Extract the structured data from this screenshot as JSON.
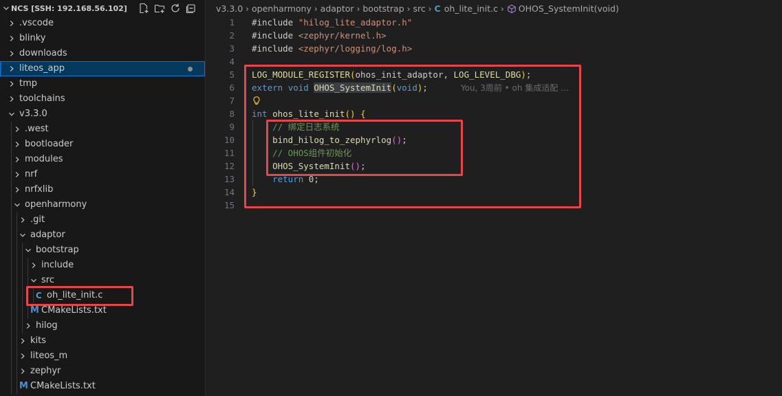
{
  "explorer": {
    "root_title": "NCS [SSH: 192.168.56.102]",
    "actions": [
      "new-file-icon",
      "new-folder-icon",
      "refresh-icon",
      "collapse-all-icon"
    ],
    "items": [
      {
        "label": ".vscode",
        "depth": 0,
        "type": "folder",
        "expanded": false
      },
      {
        "label": "blinky",
        "depth": 0,
        "type": "folder",
        "expanded": false
      },
      {
        "label": "downloads",
        "depth": 0,
        "type": "folder",
        "expanded": false
      },
      {
        "label": "liteos_app",
        "depth": 0,
        "type": "folder",
        "expanded": false,
        "selected": true,
        "modified": true
      },
      {
        "label": "tmp",
        "depth": 0,
        "type": "folder",
        "expanded": false
      },
      {
        "label": "toolchains",
        "depth": 0,
        "type": "folder",
        "expanded": false
      },
      {
        "label": "v3.3.0",
        "depth": 0,
        "type": "folder",
        "expanded": true
      },
      {
        "label": ".west",
        "depth": 1,
        "type": "folder",
        "expanded": false
      },
      {
        "label": "bootloader",
        "depth": 1,
        "type": "folder",
        "expanded": false
      },
      {
        "label": "modules",
        "depth": 1,
        "type": "folder",
        "expanded": false
      },
      {
        "label": "nrf",
        "depth": 1,
        "type": "folder",
        "expanded": false
      },
      {
        "label": "nrfxlib",
        "depth": 1,
        "type": "folder",
        "expanded": false
      },
      {
        "label": "openharmony",
        "depth": 1,
        "type": "folder",
        "expanded": true
      },
      {
        "label": ".git",
        "depth": 2,
        "type": "folder",
        "expanded": false
      },
      {
        "label": "adaptor",
        "depth": 2,
        "type": "folder",
        "expanded": true
      },
      {
        "label": "bootstrap",
        "depth": 3,
        "type": "folder",
        "expanded": true
      },
      {
        "label": "include",
        "depth": 4,
        "type": "folder",
        "expanded": false
      },
      {
        "label": "src",
        "depth": 4,
        "type": "folder",
        "expanded": true
      },
      {
        "label": "oh_lite_init.c",
        "depth": 5,
        "type": "c-file",
        "icon_text": "C"
      },
      {
        "label": "CMakeLists.txt",
        "depth": 4,
        "type": "cmake-file",
        "icon_text": "M"
      },
      {
        "label": "hilog",
        "depth": 3,
        "type": "folder",
        "expanded": false
      },
      {
        "label": "kits",
        "depth": 2,
        "type": "folder",
        "expanded": false
      },
      {
        "label": "liteos_m",
        "depth": 2,
        "type": "folder",
        "expanded": false
      },
      {
        "label": "zephyr",
        "depth": 2,
        "type": "folder",
        "expanded": false
      },
      {
        "label": "CMakeLists.txt",
        "depth": 2,
        "type": "cmake-file",
        "icon_text": "M"
      }
    ]
  },
  "breadcrumb": {
    "parts": [
      "v3.3.0",
      "openharmony",
      "adaptor",
      "bootstrap",
      "src"
    ],
    "file_icon": "C",
    "file": "oh_lite_init.c",
    "symbol": "OHOS_SystemInit(void)"
  },
  "code": {
    "lines": [
      {
        "n": "1",
        "tokens": [
          [
            "kw-pp",
            "#include "
          ],
          [
            "str",
            "\"hilog_lite_adaptor.h\""
          ]
        ]
      },
      {
        "n": "2",
        "tokens": [
          [
            "kw-pp",
            "#include "
          ],
          [
            "str",
            "<zephyr/kernel.h>"
          ]
        ]
      },
      {
        "n": "3",
        "tokens": [
          [
            "kw-pp",
            "#include "
          ],
          [
            "str",
            "<zephyr/logging/log.h>"
          ]
        ]
      },
      {
        "n": "4",
        "tokens": []
      },
      {
        "n": "5",
        "tokens": [
          [
            "fn",
            "LOG_MODULE_REGISTER"
          ],
          [
            "brace",
            "("
          ],
          [
            "plain",
            "ohos_init_adaptor, "
          ],
          [
            "fn",
            "LOG_LEVEL_DBG"
          ],
          [
            "brace",
            ")"
          ],
          [
            "plain",
            ";"
          ]
        ]
      },
      {
        "n": "6",
        "tokens": [
          [
            "kw",
            "extern "
          ],
          [
            "kw",
            "void "
          ],
          [
            "fnhl",
            "OHOS_SystemInit"
          ],
          [
            "brace",
            "("
          ],
          [
            "kw",
            "void"
          ],
          [
            "brace",
            ")"
          ],
          [
            "plain",
            ";"
          ]
        ],
        "ghost": "You, 3周前 • oh 集成适配 …"
      },
      {
        "n": "7",
        "tokens": [],
        "bulb": true
      },
      {
        "n": "8",
        "tokens": [
          [
            "kw",
            "int "
          ],
          [
            "fn",
            "ohos_lite_init"
          ],
          [
            "brace",
            "()"
          ],
          [
            "plain",
            " "
          ],
          [
            "brace",
            "{"
          ]
        ]
      },
      {
        "n": "9",
        "tokens": [
          [
            "ind",
            "    "
          ],
          [
            "cmt",
            "// 绑定日志系统"
          ]
        ]
      },
      {
        "n": "10",
        "tokens": [
          [
            "ind",
            "    "
          ],
          [
            "fn",
            "bind_hilog_to_zephyrlog"
          ],
          [
            "paren",
            "()"
          ],
          [
            "plain",
            ";"
          ]
        ]
      },
      {
        "n": "11",
        "tokens": [
          [
            "ind",
            "    "
          ],
          [
            "cmt",
            "// OHOS组件初始化"
          ]
        ]
      },
      {
        "n": "12",
        "tokens": [
          [
            "ind",
            "    "
          ],
          [
            "fn",
            "OHOS_SystemInit"
          ],
          [
            "paren",
            "()"
          ],
          [
            "plain",
            ";"
          ]
        ]
      },
      {
        "n": "13",
        "tokens": [
          [
            "ind",
            "    "
          ],
          [
            "kw2",
            "return "
          ],
          [
            "num",
            "0"
          ],
          [
            "plain",
            ";"
          ]
        ]
      },
      {
        "n": "14",
        "tokens": [
          [
            "brace",
            "}"
          ]
        ]
      },
      {
        "n": "15",
        "tokens": []
      }
    ]
  },
  "colors": {
    "highlight_box": "#e8454a",
    "selection": "#04395e",
    "accent": "#0078d4"
  }
}
